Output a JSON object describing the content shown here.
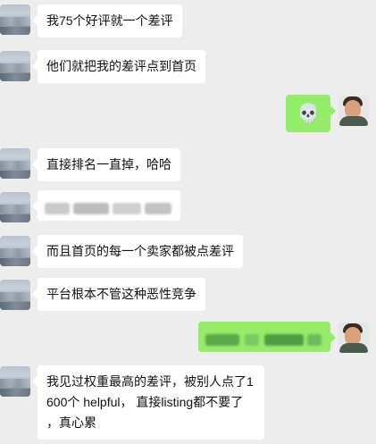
{
  "chat": {
    "messages": [
      {
        "side": "left",
        "text": "我75个好评就一个差评"
      },
      {
        "side": "left",
        "text": "他们就把我的差评点到首页"
      },
      {
        "side": "right",
        "emoji": "💀"
      },
      {
        "side": "left",
        "text": "直接排名一直掉，哈哈"
      },
      {
        "side": "left",
        "blurred": true
      },
      {
        "side": "left",
        "text": "而且首页的每一个卖家都被点差评"
      },
      {
        "side": "left",
        "text": "平台根本不管这种恶性竞争"
      },
      {
        "side": "right",
        "blurred": true
      },
      {
        "side": "left",
        "lines": [
          "我见过权重最高的差评，被别人点了1",
          "600个 helpful， 直接listing都不要了",
          "，真心累"
        ]
      }
    ]
  },
  "colors": {
    "background": "#ededed",
    "bubble_in": "#ffffff",
    "bubble_out": "#95ec69"
  },
  "icons": {
    "emoji": "skull-emoji"
  }
}
